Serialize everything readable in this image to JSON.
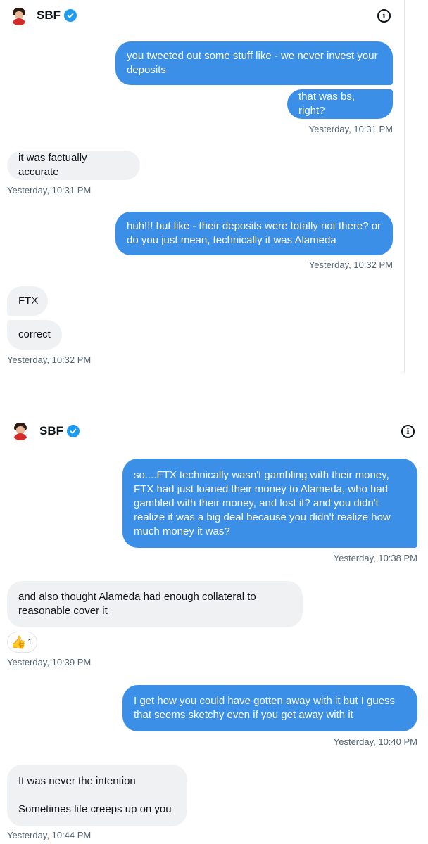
{
  "panel1": {
    "contact": {
      "name": "SBF"
    },
    "messages": [
      {
        "text": "you tweeted out some stuff like - we never invest your deposits"
      },
      {
        "text": "that was bs, right?"
      },
      {
        "timestamp": "Yesterday, 10:31 PM"
      },
      {
        "text": "it was factually accurate"
      },
      {
        "timestamp": "Yesterday, 10:31 PM"
      },
      {
        "text": "huh!!! but like - their deposits were totally not there? or do you just mean, technically it was Alameda"
      },
      {
        "timestamp": "Yesterday, 10:32 PM"
      },
      {
        "text": "FTX"
      },
      {
        "text": "correct"
      },
      {
        "timestamp": "Yesterday, 10:32 PM"
      }
    ]
  },
  "panel2": {
    "contact": {
      "name": "SBF"
    },
    "messages": [
      {
        "text": "so....FTX technically wasn't gambling with their money, FTX had just loaned their money to Alameda, who had gambled with their money, and lost it? and you didn't realize it was a big deal because you didn't realize how much money it was?"
      },
      {
        "timestamp": "Yesterday, 10:38 PM"
      },
      {
        "text": "and also thought Alameda had enough collateral to reasonable cover it"
      },
      {
        "reaction_icon": "thumbs-up-icon",
        "reaction_count": "1"
      },
      {
        "timestamp": "Yesterday, 10:39 PM"
      },
      {
        "text": "I get how you could have gotten away with it but I guess that seems sketchy even if you get away with it"
      },
      {
        "timestamp": "Yesterday, 10:40 PM"
      },
      {
        "text_line1": "It was never the intention",
        "text_line2": "Sometimes life creeps up on you"
      },
      {
        "timestamp": "Yesterday, 10:44 PM"
      }
    ]
  },
  "colors": {
    "sent_bubble": "#3b8fe6",
    "received_bubble": "#eff1f3",
    "verified": "#1d9bf0",
    "timestamp": "#536471"
  },
  "icons": {
    "verified": "verified-badge-icon",
    "info": "info-icon",
    "avatar": "avatar"
  }
}
